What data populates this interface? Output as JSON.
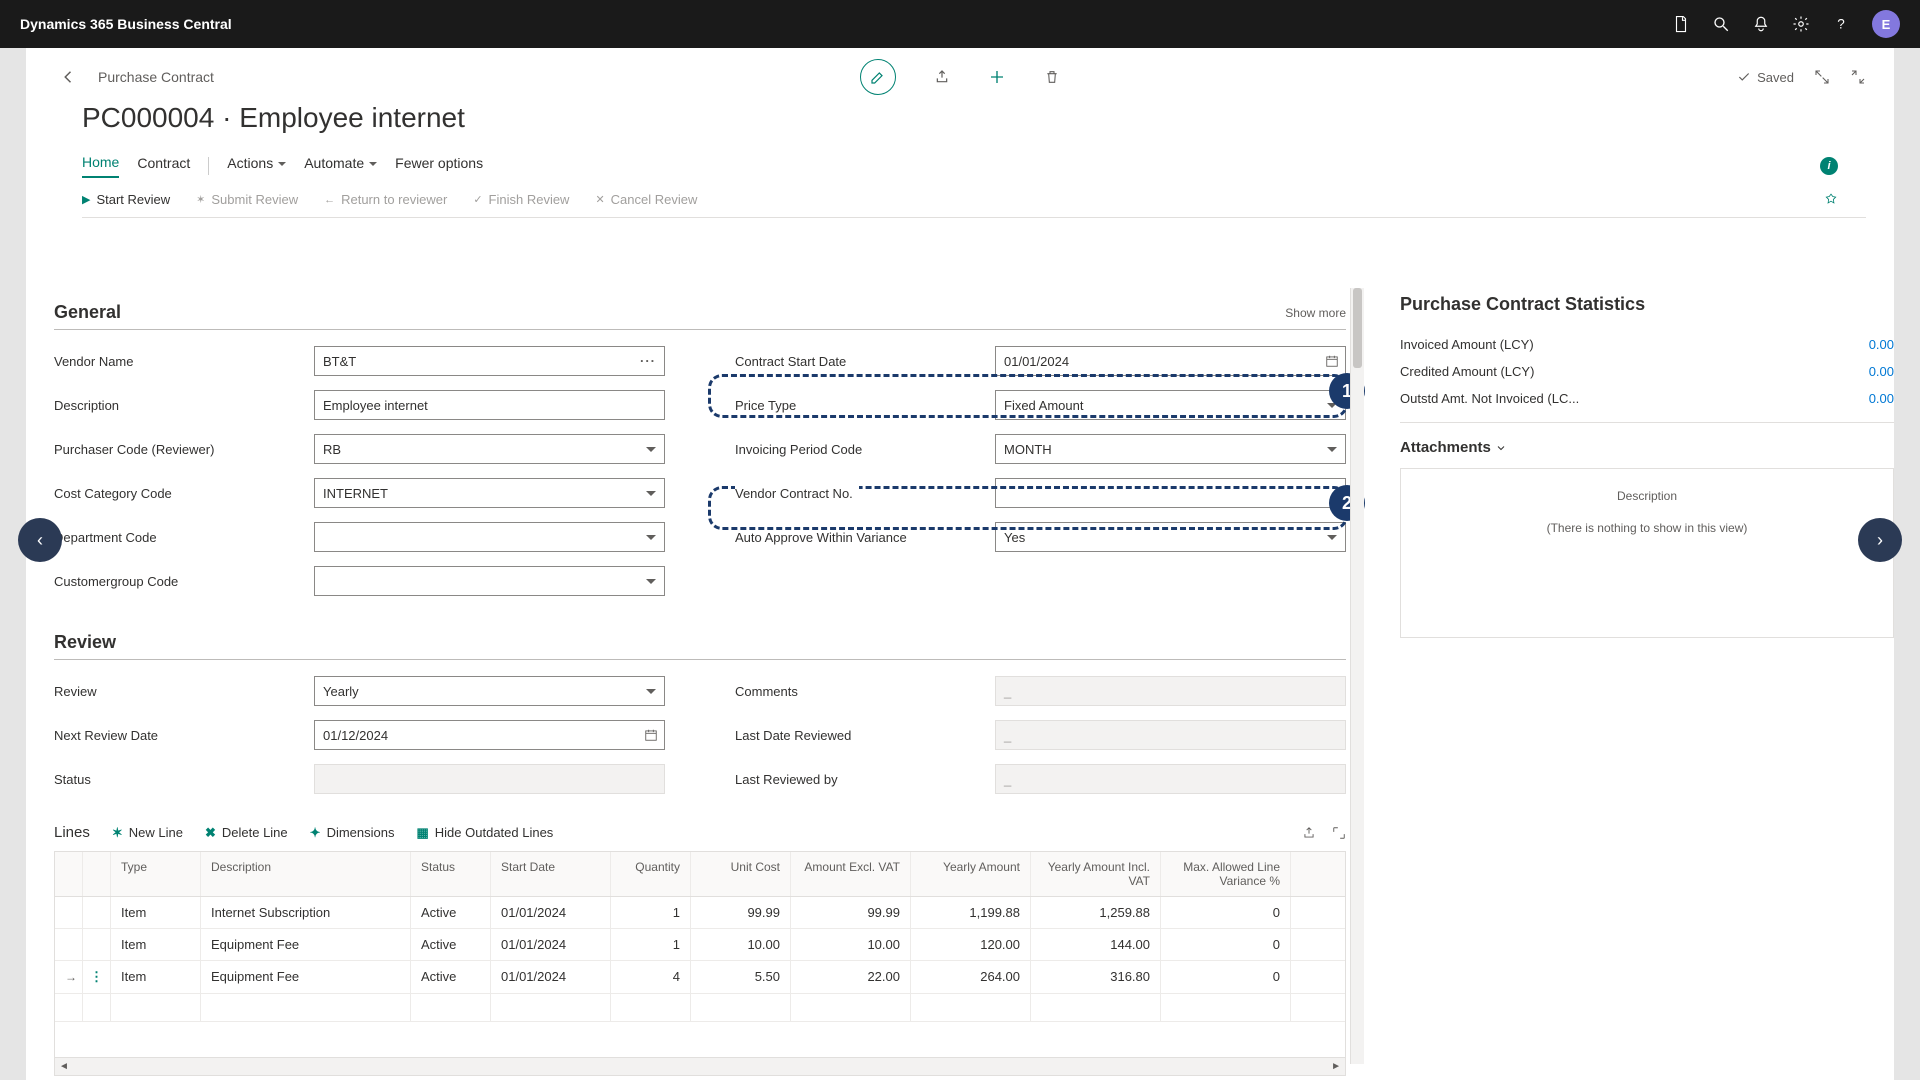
{
  "titlebar": {
    "product": "Dynamics 365 Business Central",
    "avatar_initial": "E"
  },
  "header": {
    "breadcrumb": "Purchase Contract",
    "title": "PC000004 · Employee internet",
    "saved_label": "Saved"
  },
  "tabs": {
    "home": "Home",
    "contract": "Contract",
    "actions": "Actions",
    "automate": "Automate",
    "fewer": "Fewer options"
  },
  "review_actions": {
    "start": "Start Review",
    "submit": "Submit Review",
    "return": "Return to reviewer",
    "finish": "Finish Review",
    "cancel": "Cancel Review"
  },
  "general": {
    "title": "General",
    "show_more": "Show more",
    "vendor_name_label": "Vendor Name",
    "vendor_name": "BT&T",
    "description_label": "Description",
    "description": "Employee internet",
    "purchaser_label": "Purchaser Code (Reviewer)",
    "purchaser": "RB",
    "cost_cat_label": "Cost Category Code",
    "cost_cat": "INTERNET",
    "dept_label": "Department Code",
    "dept": "",
    "custgroup_label": "Customergroup Code",
    "custgroup": "",
    "start_date_label": "Contract Start Date",
    "start_date": "01/01/2024",
    "price_type_label": "Price Type",
    "price_type": "Fixed Amount",
    "inv_period_label": "Invoicing Period Code",
    "inv_period": "MONTH",
    "vendor_contract_label": "Vendor Contract No.",
    "vendor_contract": "",
    "auto_approve_label": "Auto Approve Within Variance",
    "auto_approve": "Yes"
  },
  "review": {
    "title": "Review",
    "review_label": "Review",
    "review": "Yearly",
    "next_date_label": "Next Review Date",
    "next_date": "01/12/2024",
    "status_label": "Status",
    "status": "",
    "comments_label": "Comments",
    "comments": "_",
    "last_date_label": "Last Date Reviewed",
    "last_date": "_",
    "last_by_label": "Last Reviewed by",
    "last_by": "_"
  },
  "lines": {
    "title": "Lines",
    "new_line": "New Line",
    "delete_line": "Delete Line",
    "dimensions": "Dimensions",
    "hide_outdated": "Hide Outdated Lines",
    "cols": {
      "type": "Type",
      "desc": "Description",
      "status": "Status",
      "sdate": "Start Date",
      "qty": "Quantity",
      "ucost": "Unit Cost",
      "aexvat": "Amount Excl. VAT",
      "yamt": "Yearly Amount",
      "yinc": "Yearly Amount Incl. VAT",
      "maxvar": "Max. Allowed Line Variance %"
    },
    "rows": [
      {
        "type": "Item",
        "desc": "Internet Subscription",
        "status": "Active",
        "sdate": "01/01/2024",
        "qty": "1",
        "ucost": "99.99",
        "aexvat": "99.99",
        "yamt": "1,199.88",
        "yinc": "1,259.88",
        "maxvar": "0"
      },
      {
        "type": "Item",
        "desc": "Equipment Fee",
        "status": "Active",
        "sdate": "01/01/2024",
        "qty": "1",
        "ucost": "10.00",
        "aexvat": "10.00",
        "yamt": "120.00",
        "yinc": "144.00",
        "maxvar": "0"
      },
      {
        "type": "Item",
        "desc": "Equipment Fee",
        "status": "Active",
        "sdate": "01/01/2024",
        "qty": "4",
        "ucost": "5.50",
        "aexvat": "22.00",
        "yamt": "264.00",
        "yinc": "316.80",
        "maxvar": "0"
      }
    ]
  },
  "side": {
    "stats_title": "Purchase Contract Statistics",
    "invoiced_label": "Invoiced Amount (LCY)",
    "invoiced": "0.00",
    "credited_label": "Credited Amount (LCY)",
    "credited": "0.00",
    "outstd_label": "Outstd Amt. Not Invoiced (LC...",
    "outstd": "0.00",
    "attachments_title": "Attachments",
    "attach_col": "Description",
    "attach_empty": "(There is nothing to show in this view)"
  },
  "highlights": {
    "one": "1",
    "two": "2"
  }
}
